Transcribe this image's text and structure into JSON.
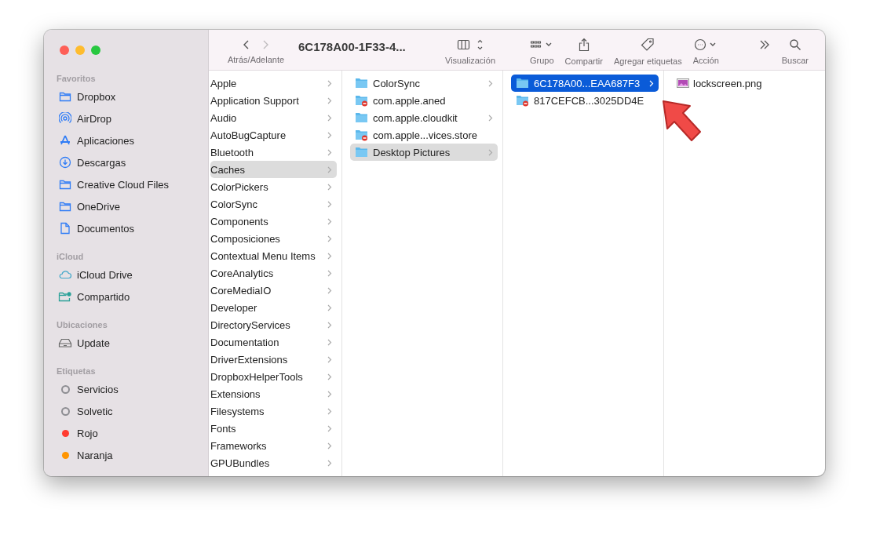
{
  "window": {
    "title": "6C178A00-1F33-4..."
  },
  "toolbar": {
    "nav": {
      "label": "Atrás/Adelante",
      "back_disabled": false,
      "forward_disabled": true
    },
    "items": [
      {
        "kind": "view",
        "label": "Visualización"
      },
      {
        "kind": "group",
        "label": "Grupo"
      },
      {
        "kind": "share",
        "label": "Compartir"
      },
      {
        "kind": "tag",
        "label": "Agregar etiquetas"
      },
      {
        "kind": "action",
        "label": "Acción"
      },
      {
        "kind": "more"
      },
      {
        "kind": "search",
        "label": "Buscar"
      }
    ]
  },
  "sidebar": {
    "sections": [
      {
        "title": "Favoritos",
        "items": [
          {
            "kind": "folder",
            "label": "Dropbox"
          },
          {
            "kind": "airdrop",
            "label": "AirDrop"
          },
          {
            "kind": "apps",
            "label": "Aplicaciones"
          },
          {
            "kind": "download",
            "label": "Descargas"
          },
          {
            "kind": "folder",
            "label": "Creative Cloud Files"
          },
          {
            "kind": "folder",
            "label": "OneDrive"
          },
          {
            "kind": "document",
            "label": "Documentos"
          }
        ]
      },
      {
        "title": "iCloud",
        "items": [
          {
            "kind": "cloud",
            "label": "iCloud Drive"
          },
          {
            "kind": "shared",
            "label": "Compartido"
          }
        ]
      },
      {
        "title": "Ubicaciones",
        "items": [
          {
            "kind": "disk",
            "label": "Update"
          }
        ]
      },
      {
        "title": "Etiquetas",
        "items": [
          {
            "kind": "tag-outline",
            "label": "Servicios",
            "color": "#8e8e93"
          },
          {
            "kind": "tag-outline",
            "label": "Solvetic",
            "color": "#8e8e93"
          },
          {
            "kind": "tag-filled",
            "label": "Rojo",
            "color": "#ff3b30"
          },
          {
            "kind": "tag-filled",
            "label": "Naranja",
            "color": "#ff9500"
          }
        ]
      }
    ]
  },
  "columns": [
    {
      "focused": false,
      "items": [
        {
          "kind": "plain",
          "label": "Apple",
          "expandable": true,
          "selected": false
        },
        {
          "kind": "plain",
          "label": "Application Support",
          "expandable": true,
          "selected": false
        },
        {
          "kind": "plain",
          "label": "Audio",
          "expandable": true,
          "selected": false
        },
        {
          "kind": "plain",
          "label": "AutoBugCapture",
          "expandable": true,
          "selected": false
        },
        {
          "kind": "plain",
          "label": "Bluetooth",
          "expandable": true,
          "selected": false
        },
        {
          "kind": "plain",
          "label": "Caches",
          "expandable": true,
          "selected": true
        },
        {
          "kind": "plain",
          "label": "ColorPickers",
          "expandable": true,
          "selected": false
        },
        {
          "kind": "plain",
          "label": "ColorSync",
          "expandable": true,
          "selected": false
        },
        {
          "kind": "plain",
          "label": "Components",
          "expandable": true,
          "selected": false
        },
        {
          "kind": "plain",
          "label": "Composiciones",
          "expandable": true,
          "selected": false
        },
        {
          "kind": "plain",
          "label": "Contextual Menu Items",
          "expandable": true,
          "selected": false
        },
        {
          "kind": "plain",
          "label": "CoreAnalytics",
          "expandable": true,
          "selected": false
        },
        {
          "kind": "plain",
          "label": "CoreMediaIO",
          "expandable": true,
          "selected": false
        },
        {
          "kind": "plain",
          "label": "Developer",
          "expandable": true,
          "selected": false
        },
        {
          "kind": "plain",
          "label": "DirectoryServices",
          "expandable": true,
          "selected": false
        },
        {
          "kind": "plain",
          "label": "Documentation",
          "expandable": true,
          "selected": false
        },
        {
          "kind": "plain",
          "label": "DriverExtensions",
          "expandable": true,
          "selected": false
        },
        {
          "kind": "plain",
          "label": "DropboxHelperTools",
          "expandable": true,
          "selected": false
        },
        {
          "kind": "plain",
          "label": "Extensions",
          "expandable": true,
          "selected": false
        },
        {
          "kind": "plain",
          "label": "Filesystems",
          "expandable": true,
          "selected": false
        },
        {
          "kind": "plain",
          "label": "Fonts",
          "expandable": true,
          "selected": false
        },
        {
          "kind": "plain",
          "label": "Frameworks",
          "expandable": true,
          "selected": false
        },
        {
          "kind": "plain",
          "label": "GPUBundles",
          "expandable": true,
          "selected": false
        }
      ]
    },
    {
      "focused": false,
      "items": [
        {
          "kind": "folder",
          "label": "ColorSync",
          "expandable": true,
          "selected": false
        },
        {
          "kind": "folder-restricted",
          "label": "com.apple.aned",
          "expandable": false,
          "selected": false
        },
        {
          "kind": "folder",
          "label": "com.apple.cloudkit",
          "expandable": true,
          "selected": false
        },
        {
          "kind": "folder-restricted",
          "label": "com.apple...vices.store",
          "expandable": false,
          "selected": false
        },
        {
          "kind": "folder",
          "label": "Desktop Pictures",
          "expandable": true,
          "selected": true
        }
      ]
    },
    {
      "focused": true,
      "items": [
        {
          "kind": "folder",
          "label": "6C178A00...EAA687F3",
          "expandable": true,
          "selected": true
        },
        {
          "kind": "folder-restricted",
          "label": "817CEFCB...3025DD4E",
          "expandable": false,
          "selected": false
        }
      ]
    },
    {
      "items": [
        {
          "kind": "image",
          "label": "lockscreen.png",
          "expandable": false,
          "selected": false
        }
      ]
    }
  ]
}
